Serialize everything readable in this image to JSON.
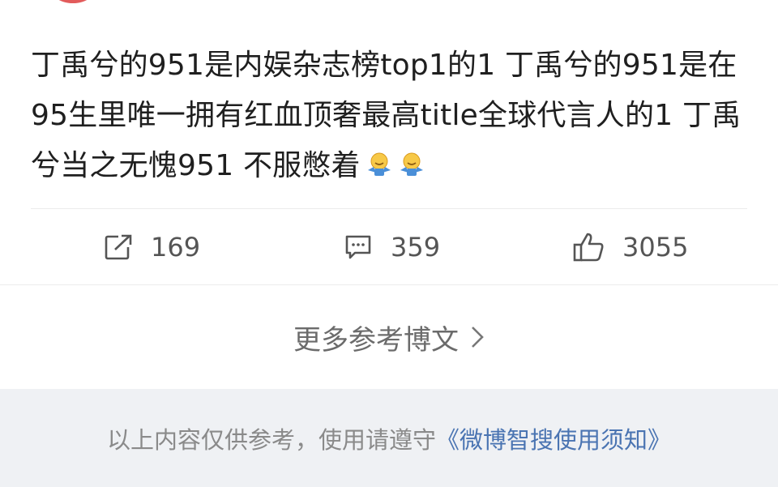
{
  "post": {
    "text": "丁禹兮的951是内娱杂志榜top1的1 丁禹兮的951是在95生里唯一拥有红血顶奢最高title全球代言人的1 丁禹兮当之无愧951 不服憋着",
    "emojis": [
      "shrug-emoji",
      "shrug-emoji"
    ]
  },
  "actions": {
    "repost_count": "169",
    "comment_count": "359",
    "like_count": "3055"
  },
  "more": {
    "label": "更多参考博文"
  },
  "footer": {
    "notice": "以上内容仅供参考，使用请遵守",
    "link": "《微博智搜使用须知》"
  },
  "colors": {
    "link": "#4a74b2",
    "footer_bg": "#eff1f4",
    "avatar": "#e25b5b"
  }
}
